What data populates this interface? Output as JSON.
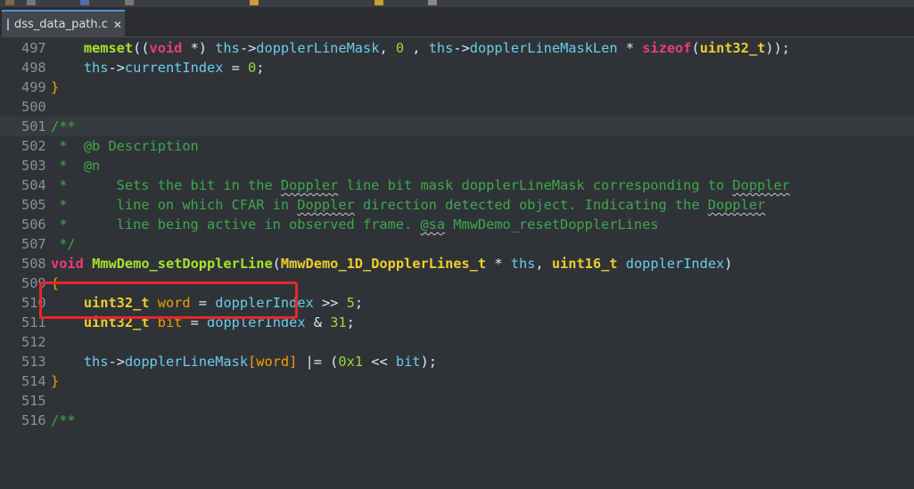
{
  "tab": {
    "file_name": "dss_data_path.c",
    "icon": "c-source-file-icon",
    "close": "✕"
  },
  "lines": [
    {
      "num": "497",
      "code": "    memset((void *) ths->dopplerLineMask, 0 , ths->dopplerLineMaskLen * sizeof(uint32_t));"
    },
    {
      "num": "498",
      "code": "    ths->currentIndex = 0;"
    },
    {
      "num": "499",
      "code": "}"
    },
    {
      "num": "500",
      "code": ""
    },
    {
      "num": "501",
      "code": "/**"
    },
    {
      "num": "502",
      "code": " *  @b Description"
    },
    {
      "num": "503",
      "code": " *  @n"
    },
    {
      "num": "504",
      "code": " *      Sets the bit in the Doppler line bit mask dopplerLineMask corresponding to Doppler"
    },
    {
      "num": "505",
      "code": " *      line on which CFAR in Doppler direction detected object. Indicating the Doppler"
    },
    {
      "num": "506",
      "code": " *      line being active in observed frame. @sa MmwDemo_resetDopplerLines"
    },
    {
      "num": "507",
      "code": " */"
    },
    {
      "num": "508",
      "code": "void MmwDemo_setDopplerLine(MmwDemo_1D_DopplerLines_t * ths, uint16_t dopplerIndex)"
    },
    {
      "num": "509",
      "code": "{"
    },
    {
      "num": "510",
      "code": "    uint32_t word = dopplerIndex >> 5;"
    },
    {
      "num": "511",
      "code": "    uint32_t bit = dopplerIndex & 31;"
    },
    {
      "num": "512",
      "code": ""
    },
    {
      "num": "513",
      "code": "    ths->dopplerLineMask[word] |= (0x1 << bit);"
    },
    {
      "num": "514",
      "code": "}"
    },
    {
      "num": "515",
      "code": ""
    },
    {
      "num": "516",
      "code": "/**"
    }
  ],
  "highlight": {
    "function_name": "MmwDemo_setDopplerLine",
    "color": "#e8262a"
  }
}
